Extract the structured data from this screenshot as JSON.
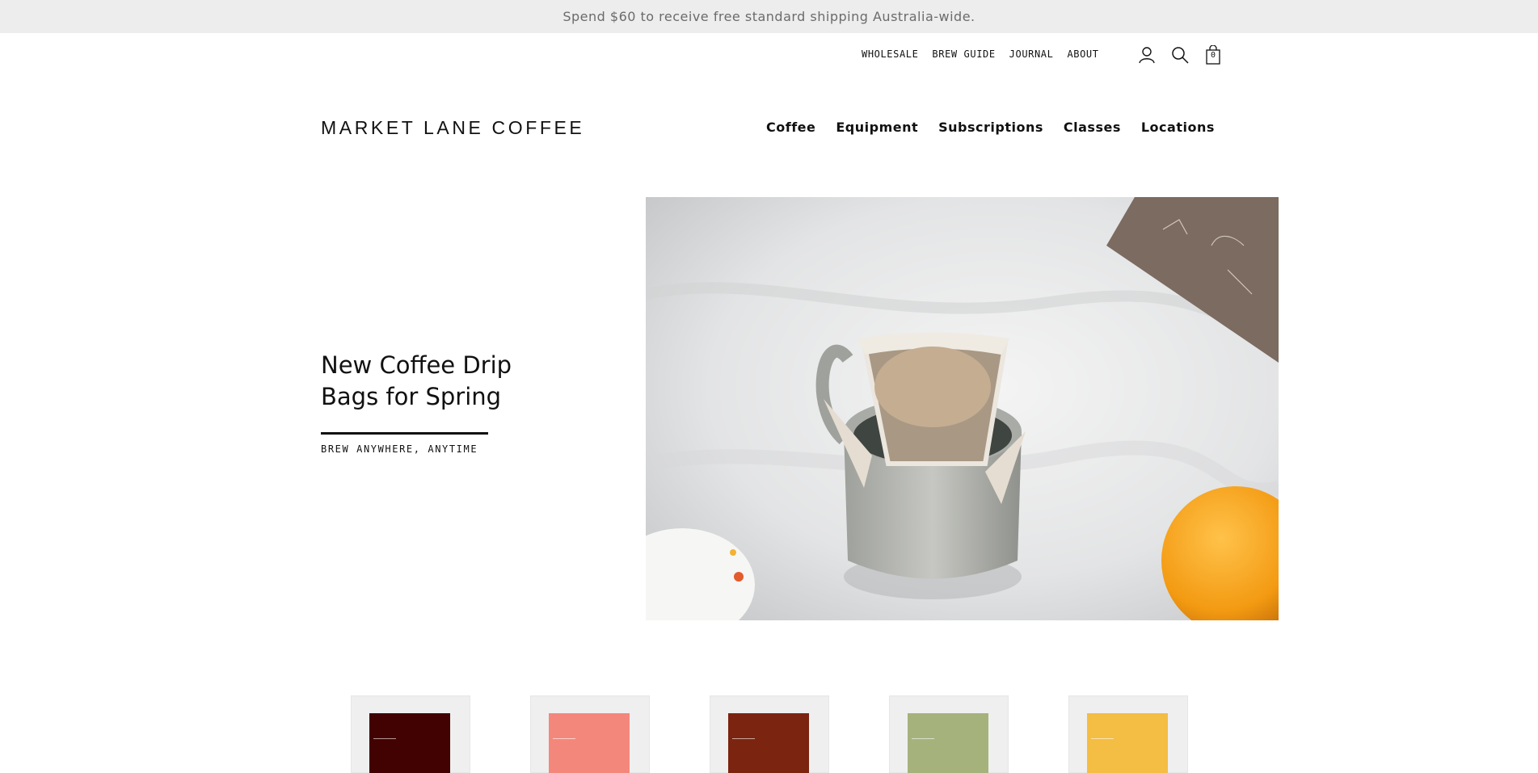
{
  "announcement": {
    "text": "Spend $60 to receive free standard shipping Australia-wide."
  },
  "utility_nav": {
    "links": [
      "WHOLESALE",
      "BREW GUIDE",
      "JOURNAL",
      "ABOUT"
    ],
    "icons": [
      "account-icon",
      "search-icon",
      "cart-icon"
    ],
    "cart_count": "0"
  },
  "logo": {
    "text": "MARKET LANE COFFEE"
  },
  "main_nav": {
    "items": [
      "Coffee",
      "Equipment",
      "Subscriptions",
      "Classes",
      "Locations"
    ]
  },
  "hero": {
    "title_line1": "New Coffee Drip",
    "title_line2": "Bags for Spring",
    "cta": "BREW ANYWHERE, ANYTIME"
  },
  "products": [
    {
      "color": "#420202"
    },
    {
      "color": "#f4877b"
    },
    {
      "color": "#7b2410"
    },
    {
      "color": "#a6b27c"
    },
    {
      "color": "#f4bd43"
    }
  ]
}
